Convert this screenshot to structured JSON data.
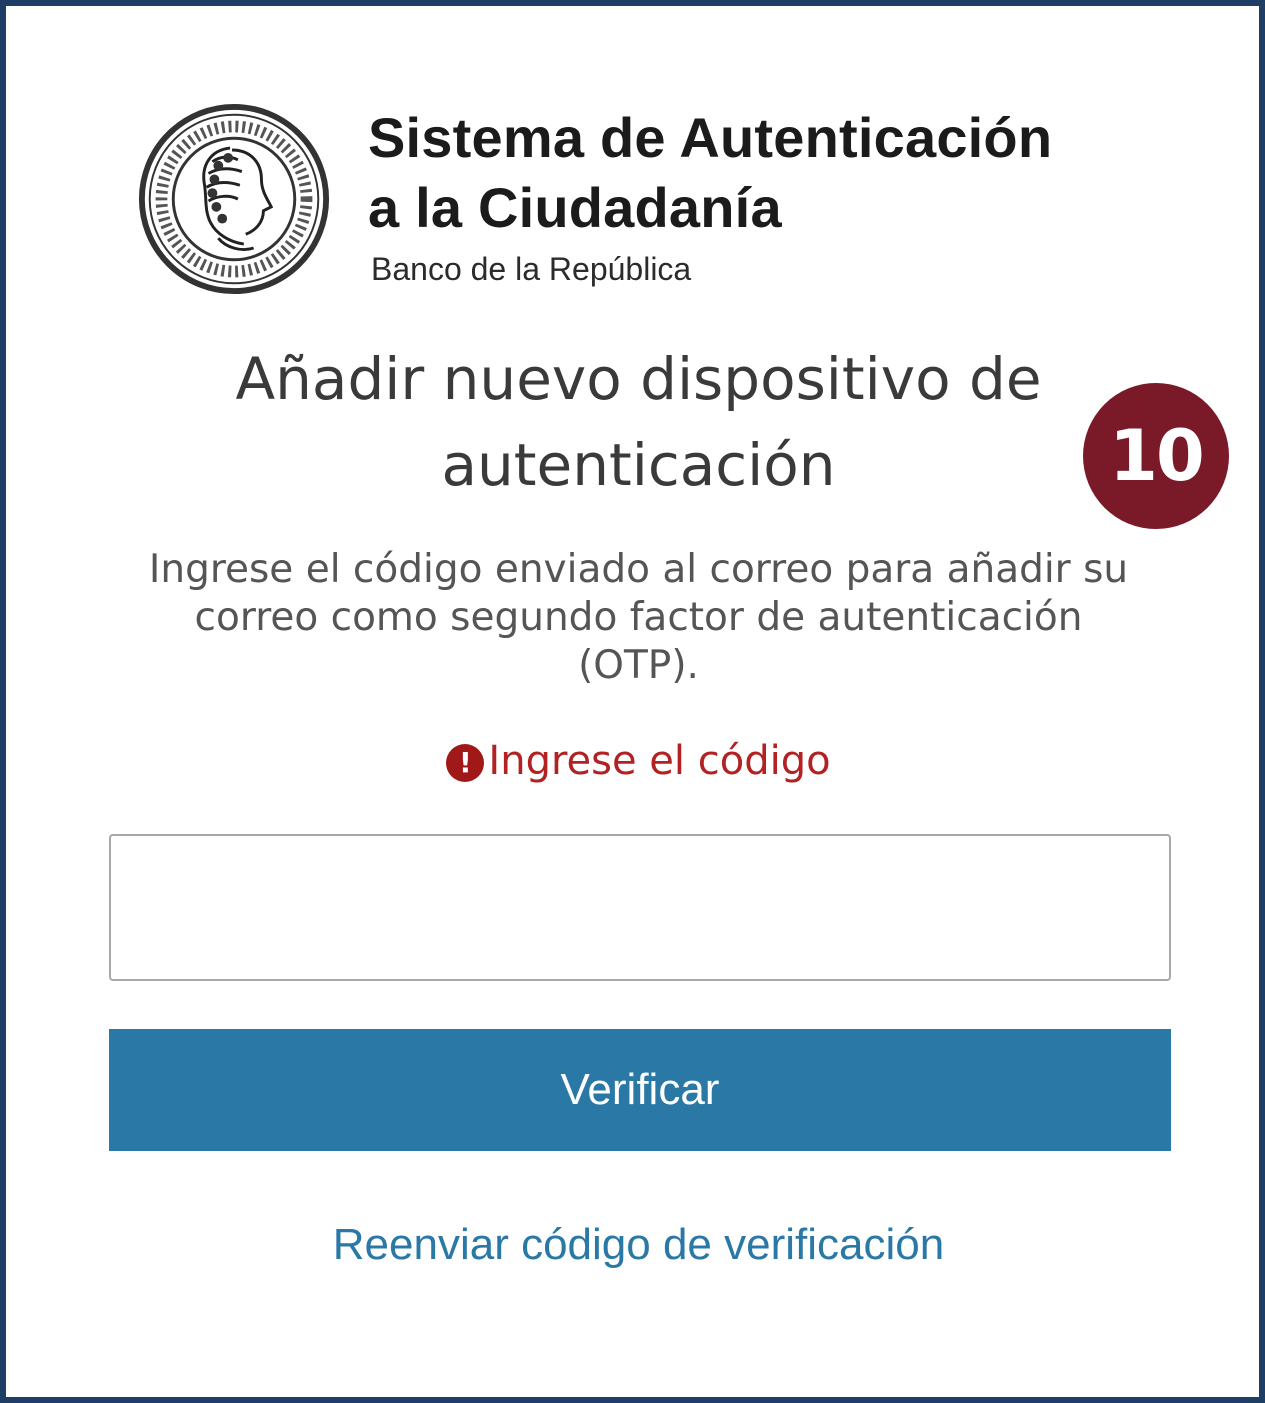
{
  "header": {
    "logo_icon": "banco-de-la-republica-seal",
    "title_line1": "Sistema de Autenticación",
    "title_line2": "a la Ciudadanía",
    "subtitle": "Banco de la República"
  },
  "main": {
    "title_line1": "Añadir nuevo dispositivo de",
    "title_line2": "autenticación",
    "step_badge": "10",
    "instructions_line1": "Ingrese el código enviado al correo para añadir su",
    "instructions_line2": "correo como segundo factor de autenticación",
    "instructions_line3": "(OTP).",
    "error": {
      "icon": "exclamation-circle-icon",
      "glyph": "!",
      "text": "Ingrese el código"
    },
    "code_input": {
      "value": "",
      "placeholder": ""
    },
    "verify_label": "Verificar",
    "resend_label": "Reenviar código de verificación"
  },
  "colors": {
    "frame_border": "#1f3e66",
    "button_bg": "#2a78a6",
    "link": "#2a78a6",
    "error": "#b22222",
    "badge_bg": "#7a1a28"
  }
}
